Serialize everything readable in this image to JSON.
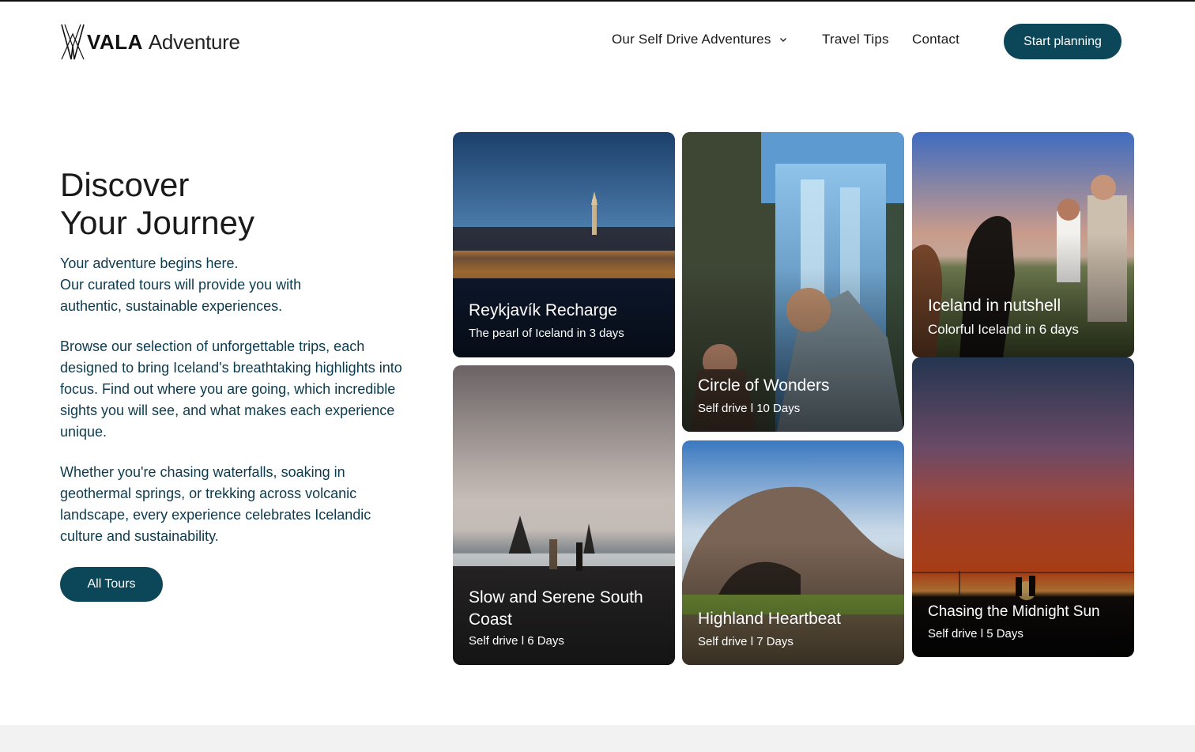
{
  "header": {
    "logo_primary": "VALA",
    "logo_secondary": "Adventure",
    "nav": {
      "adventures": "Our Self Drive Adventures",
      "tips": "Travel Tips",
      "contact": "Contact"
    },
    "cta": "Start planning"
  },
  "hero": {
    "title_line1": "Discover",
    "title_line2": "Your Journey",
    "intro": [
      "Your adventure begins here.",
      "Our curated tours will provide you with",
      "authentic, sustainable experiences."
    ],
    "paragraph2": "Browse our selection of unforgettable trips, each designed to bring Iceland's breathtaking highlights into focus. Find out where you are going, which incredible sights you will see, and what makes each experience unique.",
    "paragraph3": "Whether you're chasing waterfalls, soaking in geothermal springs, or trekking across volcanic landscape, every experience celebrates Icelandic culture and sustainability.",
    "button": "All Tours"
  },
  "tours": [
    {
      "title": "Reykjavík Recharge",
      "subtitle": "The pearl of Iceland in 3 days"
    },
    {
      "title": "Slow and Serene South Coast",
      "subtitle": "Self drive l 6 Days"
    },
    {
      "title": "Circle of Wonders",
      "subtitle": "Self drive l 10 Days"
    },
    {
      "title": "Highland Heartbeat",
      "subtitle": "Self drive l 7 Days"
    },
    {
      "title": "Iceland in nutshell",
      "subtitle": "Colorful Iceland in 6 days"
    },
    {
      "title": "Chasing the Midnight Sun",
      "subtitle": "Self drive l 5 Days"
    }
  ],
  "colors": {
    "brand": "#0c4659",
    "text": "#0d3b4e"
  }
}
